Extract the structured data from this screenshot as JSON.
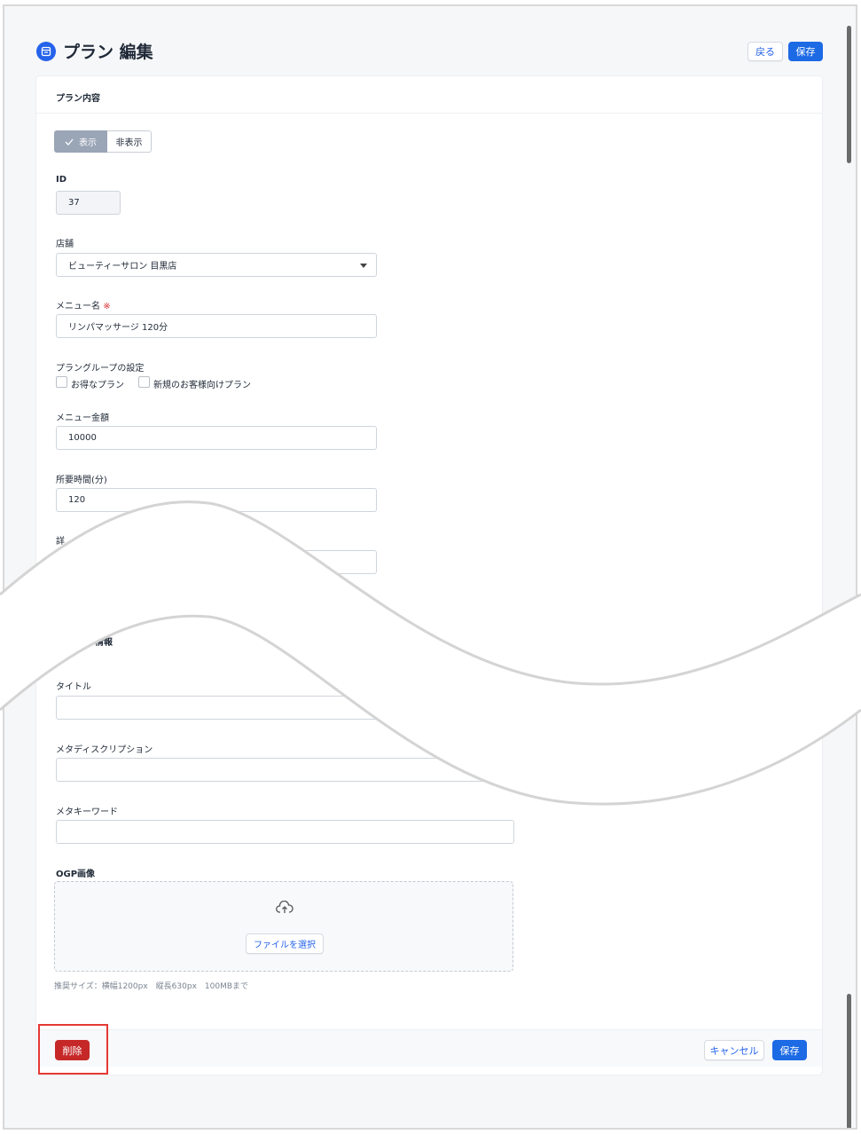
{
  "header": {
    "title": "プラン 編集",
    "back_label": "戻る",
    "save_label": "保存"
  },
  "section_plan": {
    "title": "プラン内容",
    "visibility": {
      "on_label": "表示",
      "off_label": "非表示",
      "selected": "表示"
    },
    "id": {
      "label": "ID",
      "value": "37"
    },
    "store": {
      "label": "店舗",
      "value": "ビューティーサロン 目黒店"
    },
    "menu_name": {
      "label": "メニュー名",
      "required_mark": "※",
      "value": "リンパマッサージ 120分"
    },
    "group": {
      "label": "プラングループの設定",
      "options": [
        {
          "label": "お得なプラン",
          "checked": false
        },
        {
          "label": "新規のお客様向けプラン",
          "checked": false
        }
      ]
    },
    "price": {
      "label": "メニュー金額",
      "value": "10000"
    },
    "duration": {
      "label": "所要時間(分)",
      "value": "120"
    },
    "partial_label": "詳"
  },
  "section_seo": {
    "title_partial": "情報",
    "title_field": {
      "label": "タイトル",
      "value": ""
    },
    "meta_description": {
      "label": "メタディスクリプション",
      "value": ""
    },
    "meta_keywords": {
      "label": "メタキーワード",
      "value": ""
    },
    "ogp": {
      "label": "OGP画像",
      "select_file_label": "ファイルを選択",
      "hint": "推奨サイズ：横幅1200px　縦長630px　100MBまで"
    }
  },
  "footer": {
    "delete_label": "削除",
    "cancel_label": "キャンセル",
    "save_label": "保存"
  },
  "colors": {
    "primary": "#1d6ae5",
    "danger": "#c62828",
    "highlight": "#e53935",
    "toggle_on": "#9aa5b6"
  }
}
